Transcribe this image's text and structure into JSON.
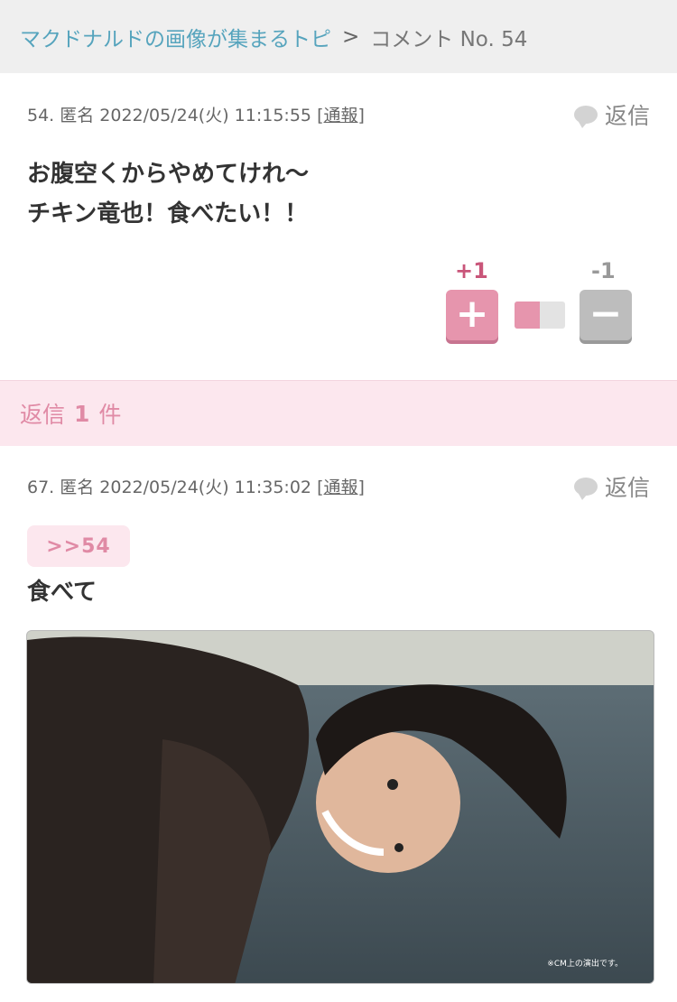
{
  "breadcrumb": {
    "topic_link": "マクドナルドの画像が集まるトピ",
    "separator": ">",
    "current": "コメント No. 54"
  },
  "comments": [
    {
      "meta": "54. 匿名 2022/05/24(火) 11:15:55",
      "report": "[通報]",
      "reply_label": "返信",
      "body_lines": [
        "お腹空くからやめてけれ〜",
        "チキン竜也！食べたい！！"
      ],
      "plus_count": "+1",
      "minus_count": "-1",
      "plus_symbol": "+",
      "minus_symbol": "−",
      "vote_ratio": 0.5
    },
    {
      "meta": "67. 匿名 2022/05/24(火) 11:35:02",
      "report": "[通報]",
      "reply_label": "返信",
      "anchor": ">>54",
      "body": "食べて",
      "image_caption": "※CM上の演出です。"
    }
  ],
  "replies": {
    "prefix": "返信",
    "count": "1",
    "suffix": "件"
  },
  "colors": {
    "accent_pink": "#e695ad",
    "link_blue": "#56a4bd",
    "reply_bar_bg": "#fce7ee"
  }
}
